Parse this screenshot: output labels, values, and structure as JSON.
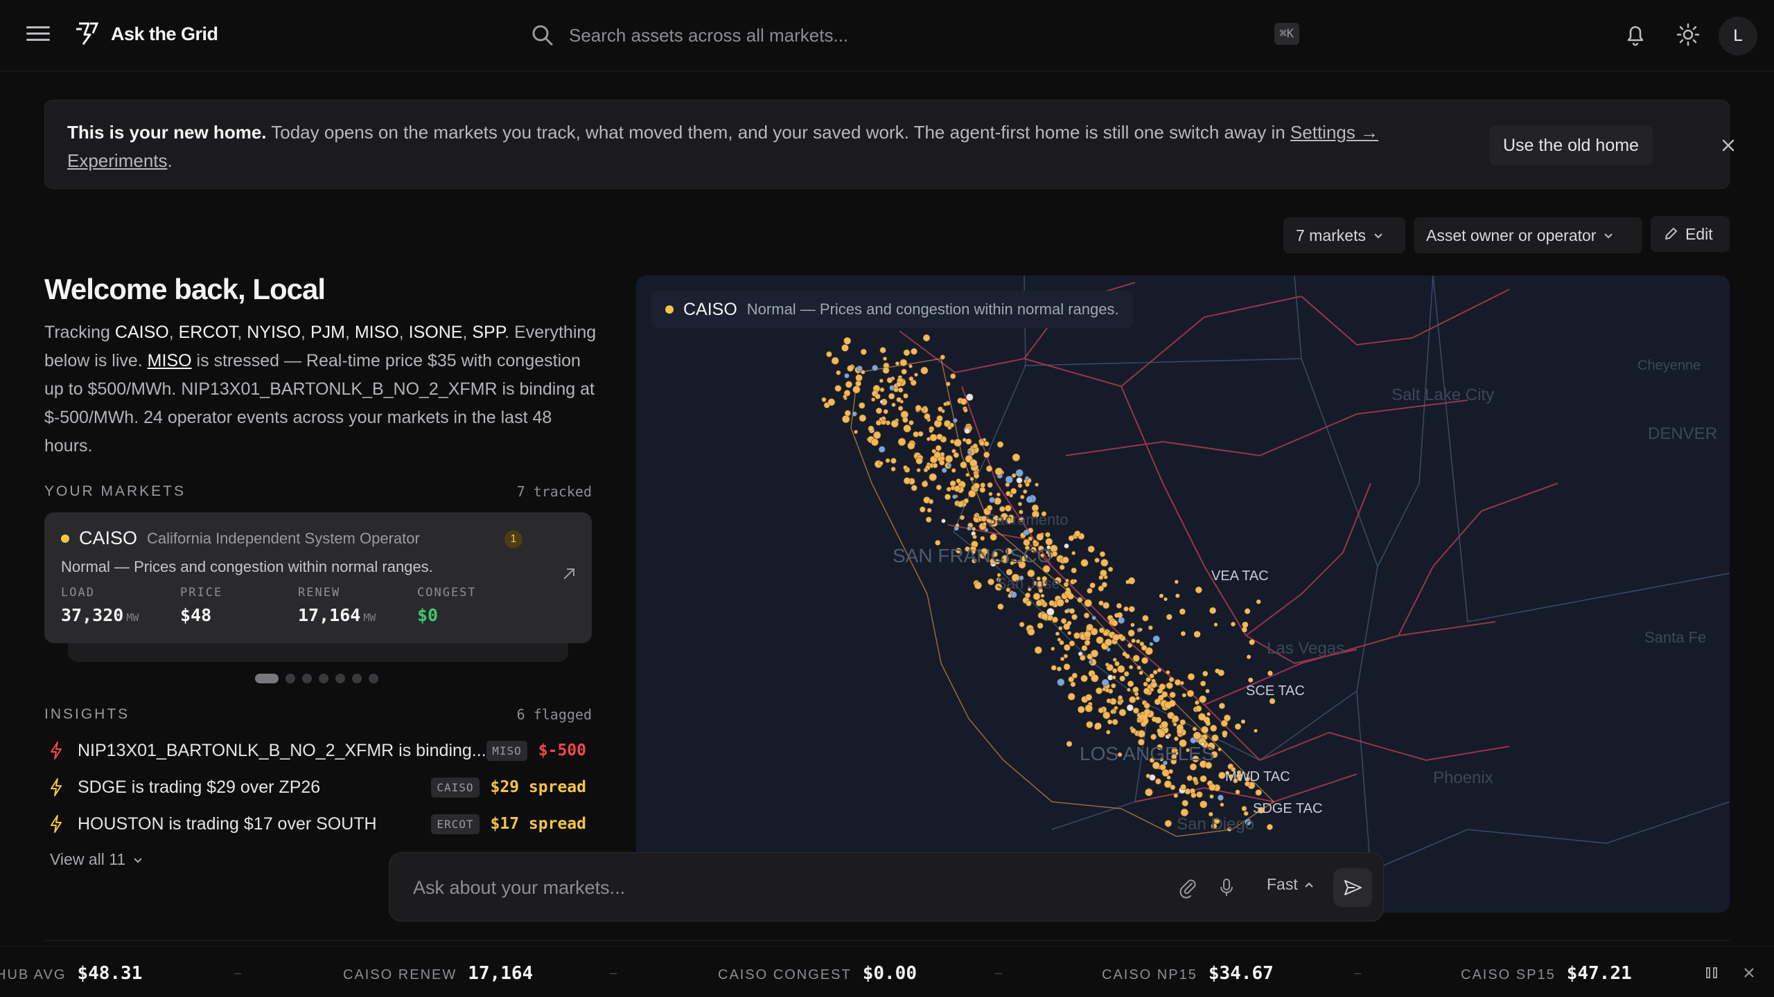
{
  "app": {
    "title": "Ask the Grid",
    "icons": {
      "menu": "hamburger-icon",
      "logo": "grid-logo-icon",
      "notifications": "bell-icon",
      "theme": "sun-icon"
    },
    "avatar_initial": "L"
  },
  "search": {
    "placeholder": "Search assets across all markets...",
    "shortcut": "⌘K"
  },
  "banner": {
    "bold": "This is your new home.",
    "text": " Today opens on the markets you track, what moved them, and your saved work. The agent-first home is still one switch away in ",
    "link": "Settings → Experiments",
    "end": ".",
    "old_home_label": "Use the old home"
  },
  "filters": {
    "markets_label": "7 markets",
    "role_label": "Asset owner or operator",
    "edit_label": "Edit"
  },
  "welcome": {
    "title": "Welcome back, Local",
    "tracking_prefix": "Tracking ",
    "markets": [
      "CAISO",
      "ERCOT",
      "NYISO",
      "PJM",
      "MISO",
      "ISONE",
      "SPP"
    ],
    "seps": [
      ", ",
      ", ",
      ", ",
      ", ",
      ", ",
      ", ",
      "."
    ],
    "live_prefix": " Everything below is live. ",
    "stressed_market": "MISO",
    "stressed_text": " is stressed — Real-time price $35 with congestion up to $500/MWh. NIP13X01_BARTONLK_B_NO_2_XFMR is binding at $-500/MWh. 24 operator events across your markets in the last 48 hours."
  },
  "your_markets": {
    "title": "YOUR MARKETS",
    "count": "7 tracked",
    "active_slide": 0,
    "slide_count": 7,
    "card": {
      "name": "CAISO",
      "full_name": "California Independent System Operator",
      "badge": "1",
      "status": "Normal — Prices and congestion within normal ranges.",
      "status_color": "#f5c542",
      "metrics": [
        {
          "label": "LOAD",
          "value": "37,320",
          "unit": "MW"
        },
        {
          "label": "PRICE",
          "value": "$48",
          "unit": ""
        },
        {
          "label": "RENEW",
          "value": "17,164",
          "unit": "MW"
        },
        {
          "label": "CONGEST",
          "value": "$0",
          "unit": ""
        }
      ]
    }
  },
  "insights": {
    "title": "INSIGHTS",
    "count": "6 flagged",
    "items": [
      {
        "icon": "bolt-icon",
        "text": "NIP13X01_BARTONLK_B_NO_2_XFMR is binding...",
        "tag": "MISO",
        "value": "$-500",
        "color": "#f04848"
      },
      {
        "icon": "bolt-icon",
        "text": "SDGE is trading $29 over ZP26",
        "tag": "CAISO",
        "value": "$29 spread",
        "color": "#f5c542"
      },
      {
        "icon": "bolt-icon",
        "text": "HOUSTON is trading $17 over SOUTH",
        "tag": "ERCOT",
        "value": "$17 spread",
        "color": "#f5c542"
      }
    ],
    "view_all": "View all 11"
  },
  "map": {
    "chip_name": "CAISO",
    "chip_text": "Normal — Prices and congestion within normal ranges.",
    "labels": [
      "VEA TAC",
      "SCE TAC",
      "SDGE TAC",
      "MWD TAC",
      "SAN FRANCISCO",
      "LOS ANGELES",
      "Las Vegas",
      "Salt Lake City",
      "DENVER",
      "Santa Fe",
      "Phoenix",
      "San Diego",
      "Sacramento",
      "San Jose",
      "Cheyenne"
    ]
  },
  "ask": {
    "placeholder": "Ask about your markets...",
    "mode": "Fast"
  },
  "ticker": {
    "items": [
      {
        "label": "HUB AVG",
        "value": "$48.31"
      },
      {
        "label": "CAISO RENEW",
        "value": "17,164"
      },
      {
        "label": "CAISO CONGEST",
        "value": "$0.00"
      },
      {
        "label": "CAISO NP15",
        "value": "$34.67"
      },
      {
        "label": "CAISO SP15",
        "value": "$47.21"
      }
    ],
    "sep": "–"
  }
}
